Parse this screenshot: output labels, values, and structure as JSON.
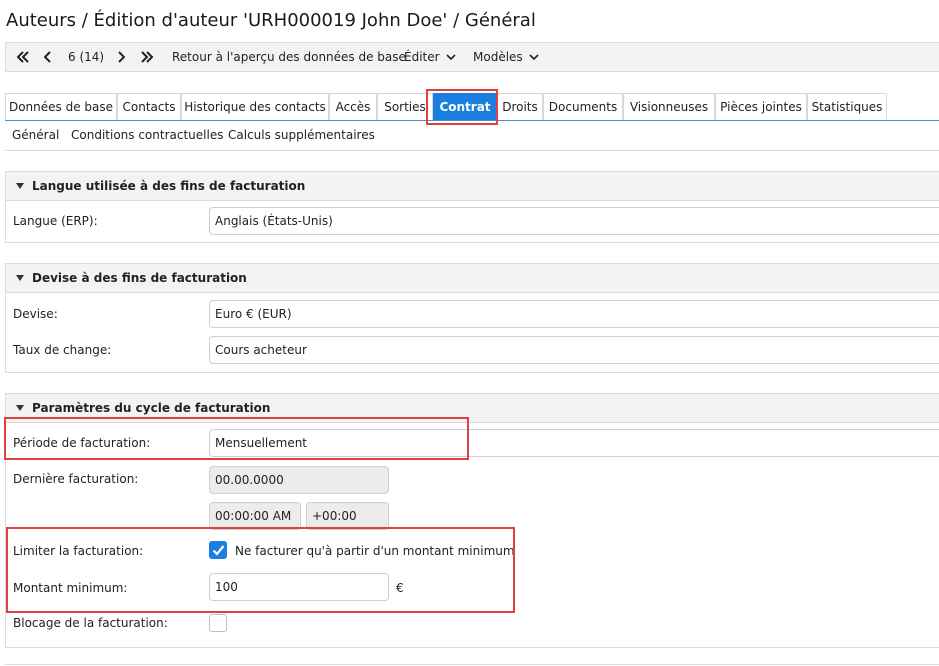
{
  "header": {
    "title": "Auteurs / Édition d'auteur 'URH000019 John Doe' / Général"
  },
  "toolbar": {
    "first_icon": "double-chevron-left-icon",
    "prev_icon": "chevron-left-icon",
    "record_position": "6 (14)",
    "next_icon": "chevron-right-icon",
    "last_icon": "double-chevron-right-icon",
    "back_label": "Retour à l'aperçu des données de base",
    "edit_label": "Éditer",
    "templates_label": "Modèles"
  },
  "tabs": [
    {
      "label": "Données de base"
    },
    {
      "label": "Contacts"
    },
    {
      "label": "Historique des contacts"
    },
    {
      "label": "Accès"
    },
    {
      "label": "Sorties"
    },
    {
      "label": "Contrat",
      "active": true
    },
    {
      "label": "Droits"
    },
    {
      "label": "Documents"
    },
    {
      "label": "Visionneuses"
    },
    {
      "label": "Pièces jointes"
    },
    {
      "label": "Statistiques"
    }
  ],
  "subtabs": [
    {
      "label": "Général"
    },
    {
      "label": "Conditions contractuelles"
    },
    {
      "label": "Calculs supplémentaires"
    }
  ],
  "sections": {
    "language": {
      "title": "Langue utilisée à des fins de facturation",
      "fields": {
        "language_label": "Langue (ERP):",
        "language_value": "Anglais (États-Unis)"
      }
    },
    "currency": {
      "title": "Devise à des fins de facturation",
      "fields": {
        "currency_label": "Devise:",
        "currency_value": "Euro € (EUR)",
        "rate_label": "Taux de change:",
        "rate_value": "Cours acheteur"
      }
    },
    "billing_cycle": {
      "title": "Paramètres du cycle de facturation",
      "fields": {
        "period_label": "Période de facturation:",
        "period_value": "Mensuellement",
        "last_billing_label": "Dernière facturation:",
        "last_billing_date": "00.00.0000",
        "last_billing_time": "00:00:00 AM",
        "last_billing_tz": "+00:00",
        "limit_label": "Limiter la facturation:",
        "limit_checkbox_label": "Ne facturer qu'à partir d'un montant minimum",
        "limit_checked": true,
        "min_amount_label": "Montant minimum:",
        "min_amount_value": "100",
        "min_amount_unit": "€",
        "block_label": "Blocage de la facturation:",
        "block_checked": false
      }
    }
  },
  "colors": {
    "accent": "#1a7fe0",
    "highlight": "#e0403f"
  }
}
